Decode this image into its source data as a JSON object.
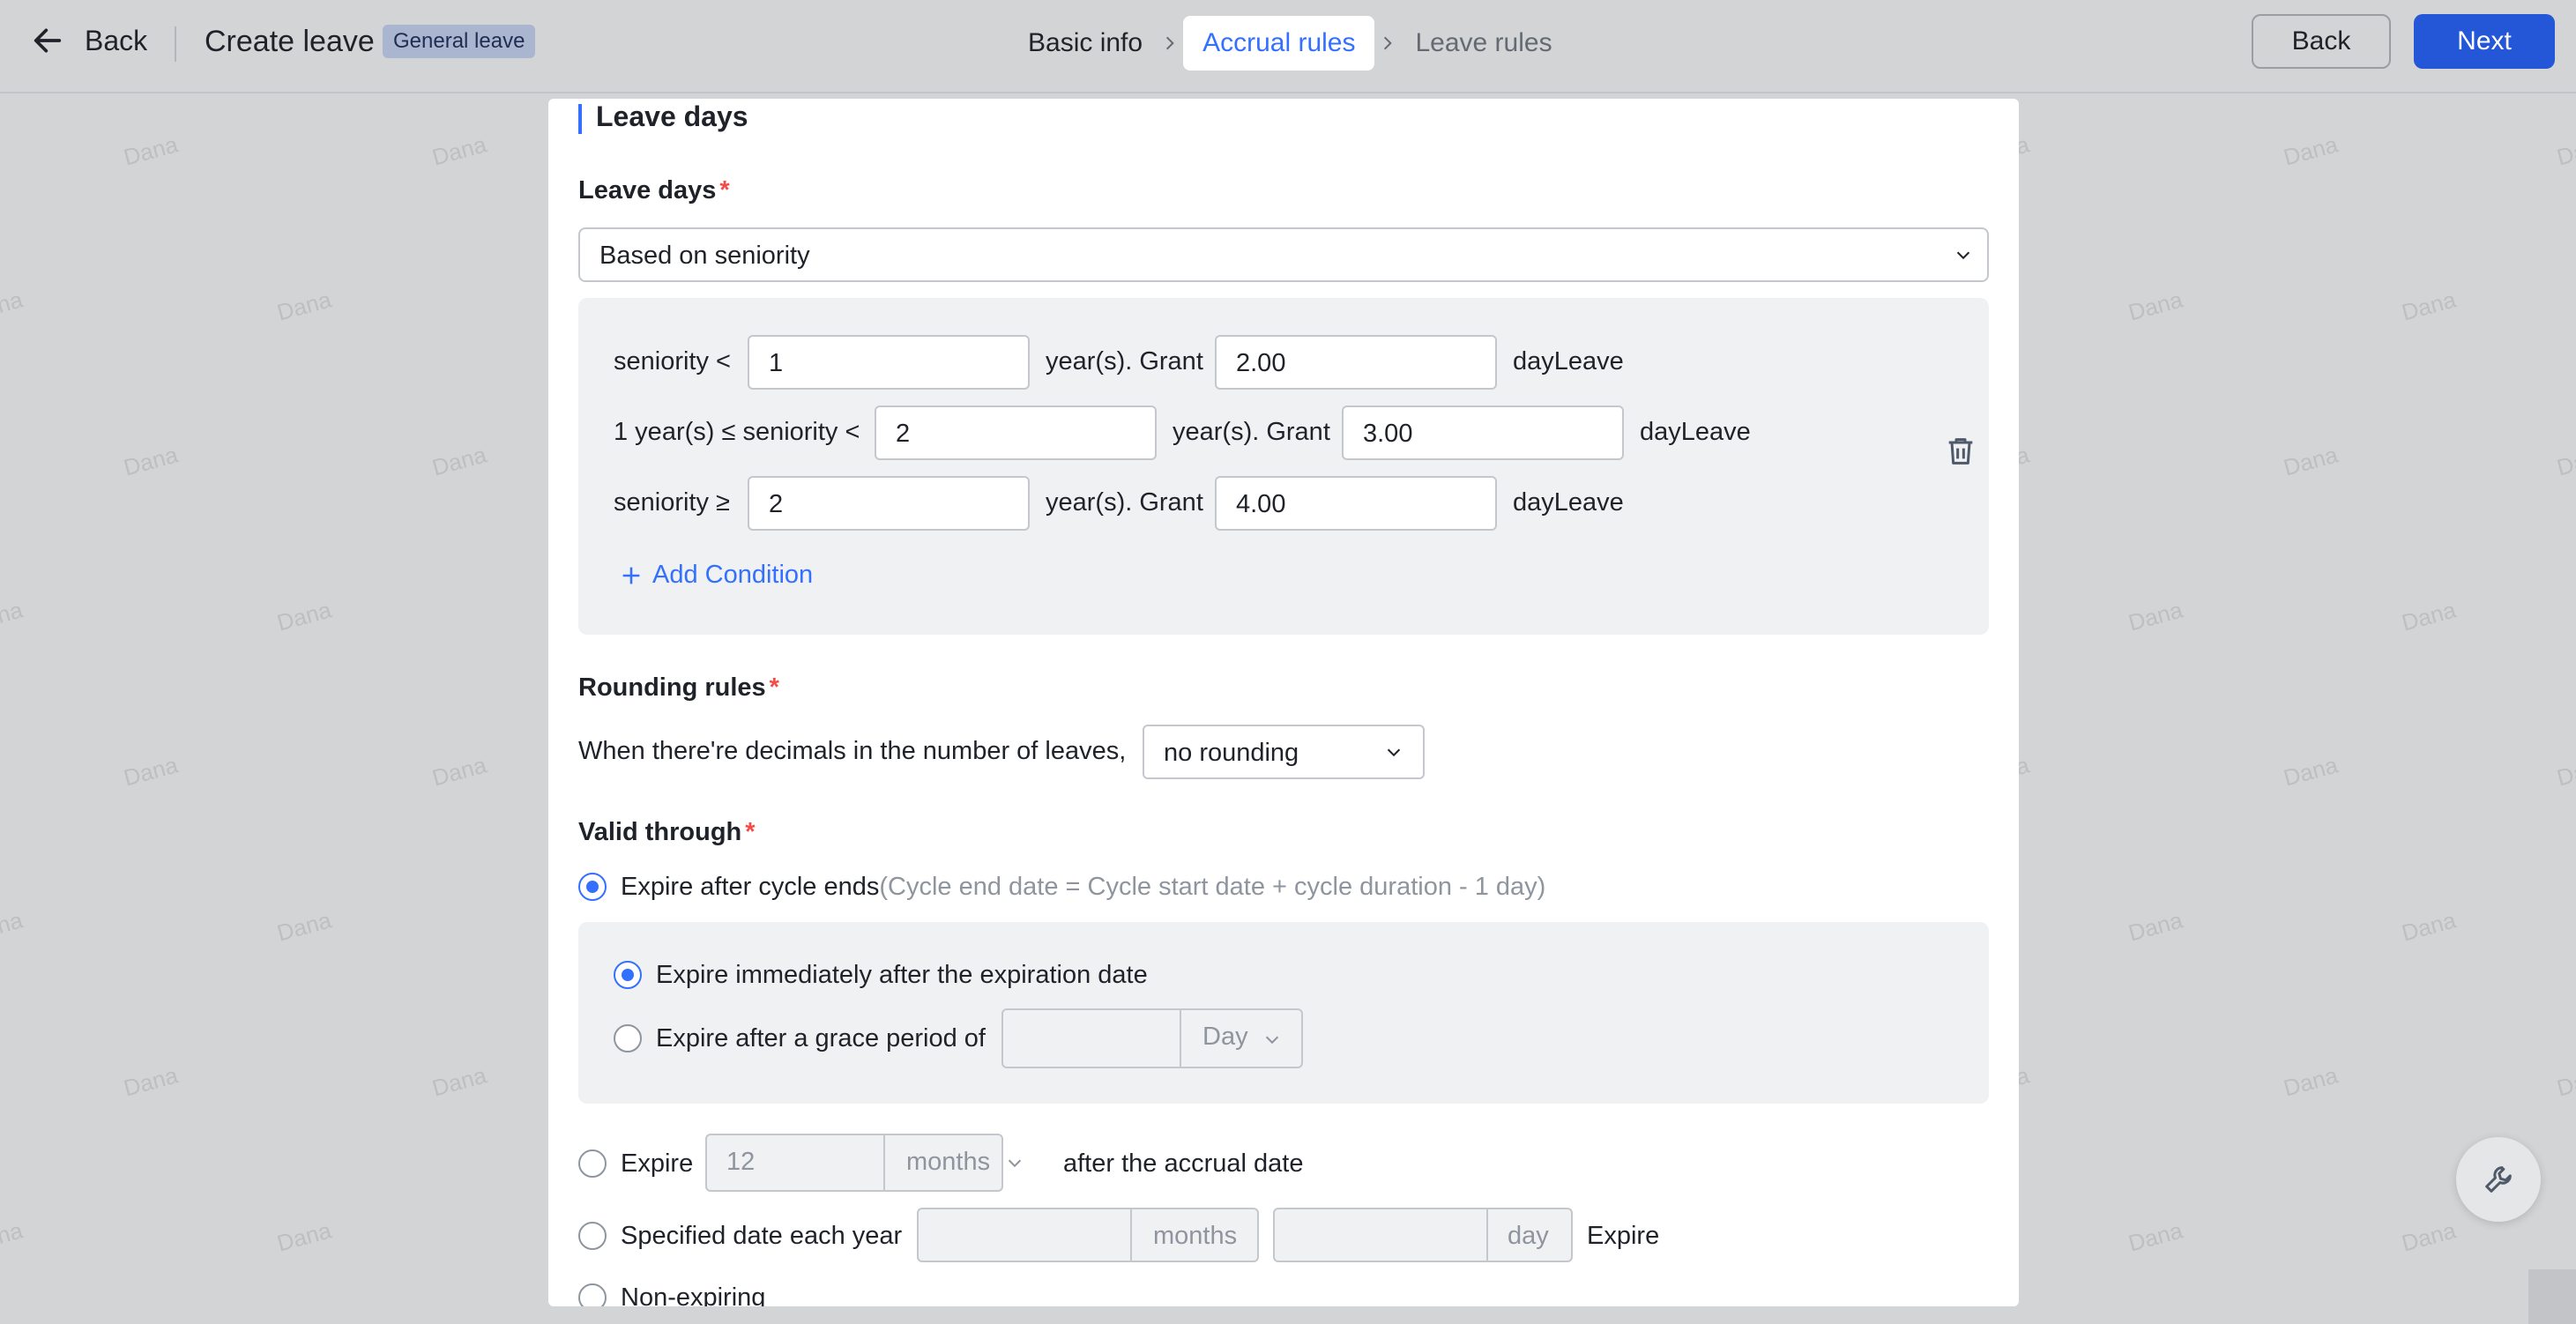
{
  "header": {
    "back_label": "Back",
    "title": "Create leave",
    "badge": "General leave",
    "steps": [
      {
        "label": "Basic info",
        "state": "done"
      },
      {
        "label": "Accrual rules",
        "state": "active"
      },
      {
        "label": "Leave rules",
        "state": "pending"
      }
    ],
    "back_button": "Back",
    "next_button": "Next"
  },
  "watermark": "Dana",
  "section": {
    "title": "Leave days"
  },
  "leave_days": {
    "label": "Leave days",
    "required": "*",
    "selected": "Based on seniority",
    "conditions": [
      {
        "prefix": "seniority <",
        "years": "1",
        "mid": "year(s). Grant",
        "days": "2.00",
        "suffix": "dayLeave"
      },
      {
        "prefix": "1 year(s) ≤ seniority <",
        "years": "2",
        "mid": "year(s). Grant",
        "days": "3.00",
        "suffix": "dayLeave"
      },
      {
        "prefix": "seniority ≥",
        "years": "2",
        "mid": "year(s). Grant",
        "days": "4.00",
        "suffix": "dayLeave"
      }
    ],
    "add_condition": "Add Condition"
  },
  "rounding": {
    "label": "Rounding rules",
    "required": "*",
    "prompt": "When there're decimals in the number of leaves,",
    "selected": "no rounding"
  },
  "valid_through": {
    "label": "Valid through",
    "required": "*",
    "opt_cycle": "Expire after cycle ends",
    "opt_cycle_note": "(Cycle end date = Cycle start date + cycle duration - 1 day)",
    "sub_immediate": "Expire immediately after the expiration date",
    "sub_grace": "Expire after a grace period of",
    "grace_value": "",
    "grace_unit": "Day",
    "opt_expire": "Expire",
    "expire_value": "12",
    "expire_unit": "months",
    "expire_after": "after the accrual date",
    "opt_specified": "Specified date each year",
    "specified_month_value": "",
    "specified_month_unit": "months",
    "specified_day_value": "",
    "specified_day_unit": "day",
    "specified_after": "Expire",
    "opt_nonexpiring": "Non-expiring"
  },
  "colors": {
    "accent": "#3370ff",
    "primary_button": "#2456d8",
    "required": "#f54a45"
  },
  "icons": [
    "arrow-left-icon",
    "chevron-right-icon",
    "chevron-down-icon",
    "trash-icon",
    "plus-icon",
    "wrench-icon"
  ]
}
